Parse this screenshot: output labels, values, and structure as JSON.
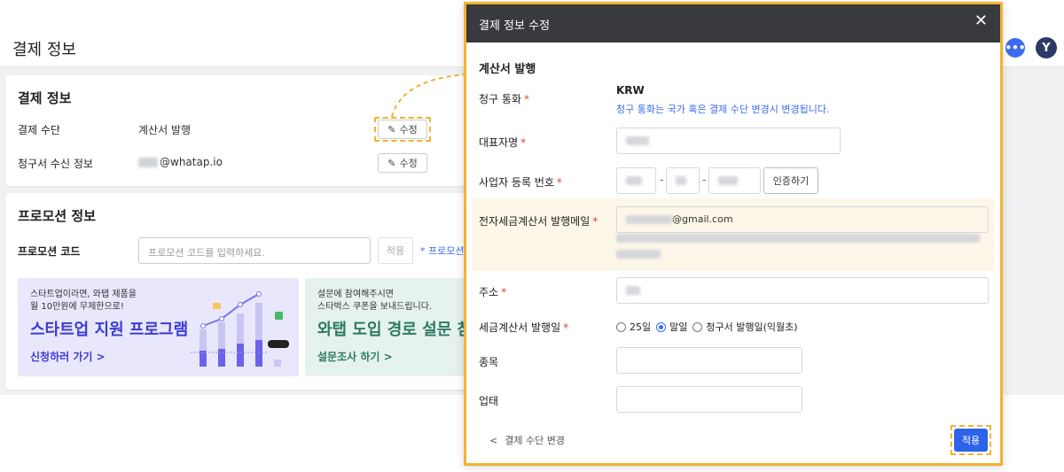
{
  "page": {
    "title": "결제 정보",
    "header_icons": {
      "chat": "chat-bubble-icon",
      "avatar_letter": "Y"
    }
  },
  "payment_card": {
    "title": "결제 정보",
    "method_label": "결제 수단",
    "method_value": "계산서 발행",
    "invoice_label": "청구서 수신 정보",
    "invoice_email_domain": "@whatap.io",
    "edit_label": "수정"
  },
  "promo_card": {
    "title": "프로모션 정보",
    "code_label": "프로모션 코드",
    "code_placeholder": "프로모션 코드를 입력하세요.",
    "apply_label": "적용",
    "note": "* 프로모션",
    "banner1": {
      "sub_line1": "스타트업이라면, 와탭 제품을",
      "sub_line2": "월 10만원에 무제한으로!",
      "title": "스타트업 지원 프로그램",
      "link": "신청하러 가기 >"
    },
    "banner2": {
      "sub_line1": "설문에 참여해주시면",
      "sub_line2": "스타벅스 쿠폰을 보내드립니다.",
      "title": "와탭 도입 경로 설문 참",
      "link": "설문조사 하기 >"
    }
  },
  "modal": {
    "title": "결제 정보 수정",
    "close_icon": "close-icon",
    "section_title": "계산서 발행",
    "currency_label": "청구 통화",
    "currency_value": "KRW",
    "currency_note": "청구 통화는 국가 혹은 결제 수단 변경시 변경됩니다.",
    "rep_name_label": "대표자명",
    "biz_no_label": "사업자 등록 번호",
    "biz_separator": "-",
    "verify_label": "인증하기",
    "email_label": "전자세금계산서 발행메일",
    "email_domain": "@gmail.com",
    "address_label": "주소",
    "issue_day_label": "세금계산서 발행일",
    "issue_options": [
      "25일",
      "말일",
      "청구서 발행일(익월초)"
    ],
    "issue_selected": "말일",
    "item_label": "종목",
    "business_type_label": "업태",
    "back_label": "결제 수단 변경",
    "apply_label": "적용",
    "required_mark": "*"
  },
  "colors": {
    "accent": "#2d63e8",
    "highlight": "#f2b32e",
    "required": "#e0413f",
    "modal_header": "#383a3d"
  }
}
